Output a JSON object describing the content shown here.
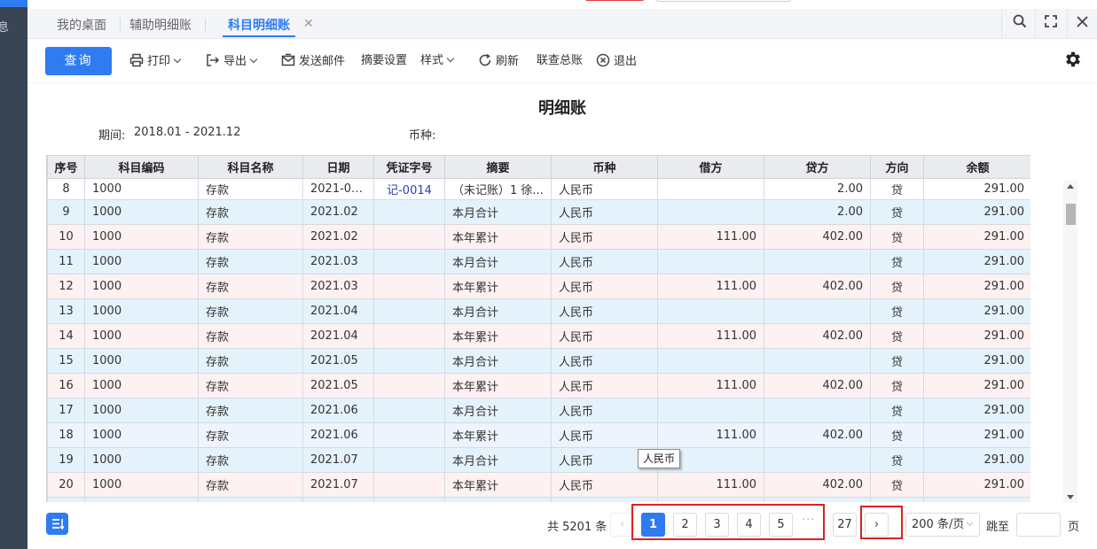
{
  "tabs": [
    {
      "label": "我的桌面"
    },
    {
      "label": "辅助明细账"
    },
    {
      "label": "科目明细账",
      "active": true
    }
  ],
  "tab_close_glyph": "✕",
  "left_strip_glyph": "息",
  "toolbar": {
    "query_label": "查询",
    "print_label": "打印",
    "export_label": "导出",
    "email_label": "发送邮件",
    "summary_settings_label": "摘要设置",
    "style_label": "样式",
    "refresh_label": "刷新",
    "ledger_label": "联查总账",
    "exit_label": "退出"
  },
  "report": {
    "title": "明细账",
    "period_label": "期间:",
    "period_value": "2018.01 - 2021.12",
    "currency_label": "币种:"
  },
  "table": {
    "columns": [
      "序号",
      "科目编码",
      "科目名称",
      "日期",
      "凭证字号",
      "摘要",
      "币种",
      "借方",
      "贷方",
      "方向",
      "余额"
    ],
    "rows": [
      {
        "seq": "8",
        "code": "1000",
        "name": "存款",
        "date": "2021-02...",
        "voucher": "记-0014",
        "summary": "（未记账）1 徐...",
        "currency": "人民币",
        "debit": "",
        "credit": "2.00",
        "direction": "贷",
        "balance": "291.00",
        "tint": "white"
      },
      {
        "seq": "9",
        "code": "1000",
        "name": "存款",
        "date": "2021.02",
        "voucher": "",
        "summary": "本月合计",
        "currency": "人民币",
        "debit": "",
        "credit": "2.00",
        "direction": "贷",
        "balance": "291.00",
        "tint": "blue"
      },
      {
        "seq": "10",
        "code": "1000",
        "name": "存款",
        "date": "2021.02",
        "voucher": "",
        "summary": "本年累计",
        "currency": "人民币",
        "debit": "111.00",
        "credit": "402.00",
        "direction": "贷",
        "balance": "291.00",
        "tint": "pink"
      },
      {
        "seq": "11",
        "code": "1000",
        "name": "存款",
        "date": "2021.03",
        "voucher": "",
        "summary": "本月合计",
        "currency": "人民币",
        "debit": "",
        "credit": "",
        "direction": "贷",
        "balance": "291.00",
        "tint": "blue"
      },
      {
        "seq": "12",
        "code": "1000",
        "name": "存款",
        "date": "2021.03",
        "voucher": "",
        "summary": "本年累计",
        "currency": "人民币",
        "debit": "111.00",
        "credit": "402.00",
        "direction": "贷",
        "balance": "291.00",
        "tint": "pink"
      },
      {
        "seq": "13",
        "code": "1000",
        "name": "存款",
        "date": "2021.04",
        "voucher": "",
        "summary": "本月合计",
        "currency": "人民币",
        "debit": "",
        "credit": "",
        "direction": "贷",
        "balance": "291.00",
        "tint": "blue"
      },
      {
        "seq": "14",
        "code": "1000",
        "name": "存款",
        "date": "2021.04",
        "voucher": "",
        "summary": "本年累计",
        "currency": "人民币",
        "debit": "111.00",
        "credit": "402.00",
        "direction": "贷",
        "balance": "291.00",
        "tint": "pink"
      },
      {
        "seq": "15",
        "code": "1000",
        "name": "存款",
        "date": "2021.05",
        "voucher": "",
        "summary": "本月合计",
        "currency": "人民币",
        "debit": "",
        "credit": "",
        "direction": "贷",
        "balance": "291.00",
        "tint": "blue"
      },
      {
        "seq": "16",
        "code": "1000",
        "name": "存款",
        "date": "2021.05",
        "voucher": "",
        "summary": "本年累计",
        "currency": "人民币",
        "debit": "111.00",
        "credit": "402.00",
        "direction": "贷",
        "balance": "291.00",
        "tint": "pink"
      },
      {
        "seq": "17",
        "code": "1000",
        "name": "存款",
        "date": "2021.06",
        "voucher": "",
        "summary": "本月合计",
        "currency": "人民币",
        "debit": "",
        "credit": "",
        "direction": "贷",
        "balance": "291.00",
        "tint": "blue"
      },
      {
        "seq": "18",
        "code": "1000",
        "name": "存款",
        "date": "2021.06",
        "voucher": "",
        "summary": "本年累计",
        "currency": "人民币",
        "debit": "111.00",
        "credit": "402.00",
        "direction": "贷",
        "balance": "291.00",
        "tint": "lav"
      },
      {
        "seq": "19",
        "code": "1000",
        "name": "存款",
        "date": "2021.07",
        "voucher": "",
        "summary": "本月合计",
        "currency": "人民币",
        "debit": "",
        "credit": "",
        "direction": "贷",
        "balance": "291.00",
        "tint": "blue"
      },
      {
        "seq": "20",
        "code": "1000",
        "name": "存款",
        "date": "2021.07",
        "voucher": "",
        "summary": "本年累计",
        "currency": "人民币",
        "debit": "111.00",
        "credit": "402.00",
        "direction": "贷",
        "balance": "291.00",
        "tint": "pink"
      },
      {
        "seq": "",
        "code": "",
        "name": "",
        "date": "",
        "voucher": "",
        "summary": "",
        "currency": "",
        "debit": "",
        "credit": "",
        "direction": "",
        "balance": "",
        "tint": "blue"
      }
    ]
  },
  "tooltip": {
    "text": "人民币"
  },
  "pagination": {
    "total_text": "共 5201 条",
    "prev_glyph": "‹",
    "pages": [
      "1",
      "2",
      "3",
      "4",
      "5"
    ],
    "current_page": "1",
    "ellipsis": "···",
    "last_page": "27",
    "next_glyph": "›",
    "page_size": "200 条/页",
    "jump_label": "跳至",
    "jump_value": "",
    "page_suffix": "页"
  },
  "colors": {
    "accent": "#2f7bf0",
    "row_blue": "#e4f2fb",
    "row_pink": "#fdf1f1",
    "highlight_box": "#e02020",
    "sidebar": "#394454"
  }
}
